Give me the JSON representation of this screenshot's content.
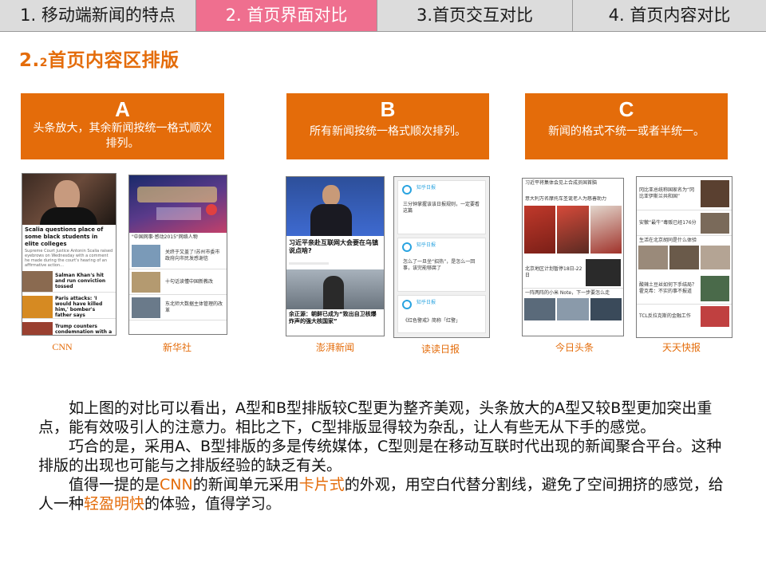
{
  "tabs": [
    {
      "label": "1. 移动端新闻的特点"
    },
    {
      "label": "2. 首页界面对比"
    },
    {
      "label": "3.首页交互对比"
    },
    {
      "label": "4. 首页内容对比"
    }
  ],
  "section": {
    "number": "2.",
    "sub_number": "2",
    "title": "首页内容区排版"
  },
  "boxes": [
    {
      "letter": "A",
      "text": "头条放大，其余新闻按统一格式顺次排列。"
    },
    {
      "letter": "B",
      "text": "所有新闻按统一格式顺次排列。"
    },
    {
      "letter": "C",
      "text": "新闻的格式不统一或者半统一。"
    }
  ],
  "apps": {
    "cnn": {
      "caption": "CNN",
      "headline": "Scalia questions place of some black students in elite colleges",
      "summary": "Supreme Court Justice Antonin Scalia raised eyebrows on Wednesday with a comment he made during the court's hearing of an affirmative action...",
      "items": [
        "Salman Khan's hit and run conviction tossed",
        "Paris attacks: 'I would have killed him,' bomber's father says",
        "Trump counters condemnation with a"
      ]
    },
    "xinhua": {
      "caption": "新华社",
      "banner": "\"中国网事·感动2015\"网络人物",
      "items": [
        "关终于又盖了!苏州市委市政府向市民发感谢信",
        "十句话读懂中国新教改",
        "东北师大数据主体管理的改革"
      ]
    },
    "pengpai": {
      "caption": "澎湃新闻",
      "headline": "习近平亲赴互联网大会要在乌镇说点啥?",
      "headline2": "余正源：朝鲜已成为“致出自卫核爆炸声的强大核国家”"
    },
    "dudu": {
      "caption": "读读日报",
      "source": "知乎日报",
      "items": [
        "三分钟掌握该该日报规则，一定要看这篇",
        "怎么了一旦坐“招热”，是怎么一回事，该完能够腐了",
        "《红色警戒》简称「红警」"
      ]
    },
    "toutiao": {
      "caption": "今日头条",
      "items": [
        "习近平将集体会见上合成员国首脑",
        "意大利万名摩托车圣诞老人为慈善助力",
        "北京地区计划暂停18日-22日",
        "一阵两阵的小米 Note，下一步要怎么走"
      ]
    },
    "tiantian": {
      "caption": "天天快报",
      "items": [
        "冈比亚总统称国家名为“冈比亚伊斯兰共和国”",
        "安徽“最牛”毒贩已经176分",
        "生活在北京胡同是什么体验",
        "酸辣土豆丝如何下手结局？霍克希：不实的事不报道",
        "TCL反拉克斯的金融工作"
      ]
    }
  },
  "paragraphs": {
    "p1": "如上图的对比可以看出，A型和B型排版较C型更为整齐美观，头条放大的A型又较B型更加突出重点，能有效吸引人的注意力。相比之下，C型排版显得较为杂乱，让人有些无从下手的感觉。",
    "p2": "巧合的是，采用A、B型排版的多是传统媒体，C型则是在移动互联时代出现的新闻聚合平台。这种排版的出现也可能与之排版经验的缺乏有关。",
    "p3_pre": "值得一提的是",
    "p3_cnn": "CNN",
    "p3_mid1": "的新闻单元采用",
    "p3_card": "卡片式",
    "p3_mid2": "的外观，用空白代替分割线，避免了空间拥挤的感觉，给人一种",
    "p3_light": "轻盈明快",
    "p3_end": "的体验，值得学习。"
  },
  "colors": {
    "accent": "#e46c0a",
    "active_tab": "#ef6f8f",
    "tab_bg": "#dcdcdc"
  }
}
